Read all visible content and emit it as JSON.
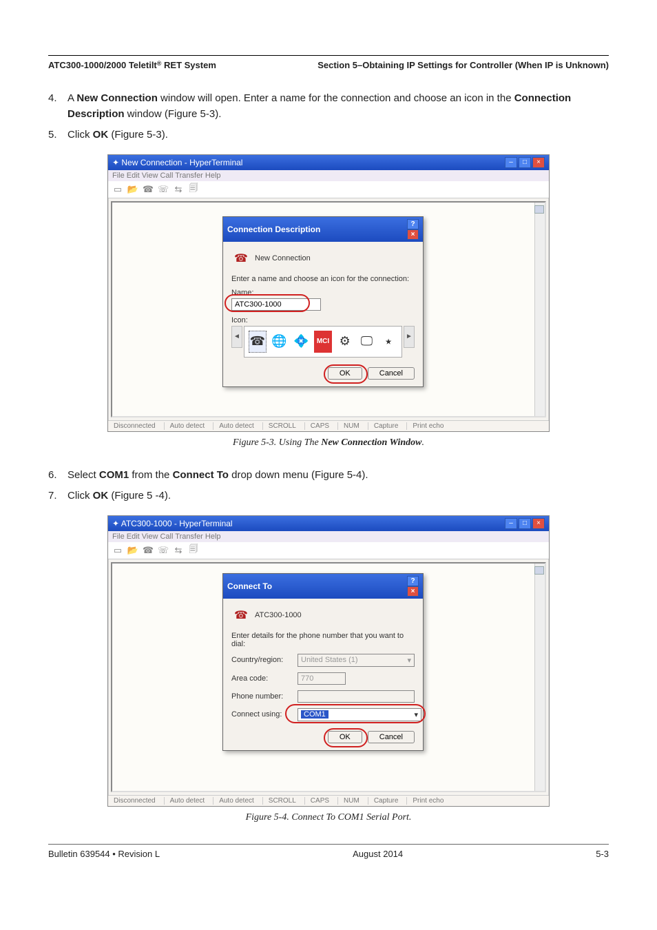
{
  "header": {
    "left": "ATC300-1000/2000 Teletilt",
    "reg": "®",
    "left2": " RET System",
    "right": "Section 5–Obtaining IP Settings for Controller (When IP is Unknown)"
  },
  "steps_a": [
    {
      "n": "4.",
      "pre": "A ",
      "b1": "New Connection",
      "mid": " window will open. Enter a name for the connection and choose an icon in the ",
      "b2": "Connection Description",
      "post": " window (Figure 5-3)."
    },
    {
      "n": "5.",
      "pre": "Click ",
      "b1": "OK",
      "mid": " (Figure 5-3).",
      "b2": "",
      "post": ""
    }
  ],
  "steps_b": [
    {
      "n": "6.",
      "pre": "Select ",
      "b1": "COM1",
      "mid": " from the ",
      "b2": "Connect To",
      "post": " drop down menu (Figure 5-4)."
    },
    {
      "n": "7.",
      "pre": "Click ",
      "b1": "OK",
      "mid": " (Figure 5 -4).",
      "b2": "",
      "post": ""
    }
  ],
  "fig1": {
    "win_title": "New Connection - HyperTerminal",
    "menu": "File  Edit  View  Call  Transfer  Help",
    "dlg_title": "Connection Description",
    "lead": "New Connection",
    "prompt": "Enter a name and choose an icon for the connection:",
    "name_label": "Name:",
    "name_value": "ATC300-1000",
    "icon_label": "Icon:",
    "ok": "OK",
    "cancel": "Cancel",
    "status": [
      "Disconnected",
      "Auto detect",
      "Auto detect",
      "SCROLL",
      "CAPS",
      "NUM",
      "Capture",
      "Print echo"
    ],
    "caption": "Figure 5-3.  Using The New Connection Window."
  },
  "fig2": {
    "win_title": "ATC300-1000 - HyperTerminal",
    "menu": "File  Edit  View  Call  Transfer  Help",
    "dlg_title": "Connect To",
    "lead": "ATC300-1000",
    "prompt": "Enter details for the phone number that you want to dial:",
    "country_label": "Country/region:",
    "country_value": "United States (1)",
    "area_label": "Area code:",
    "area_value": "770",
    "phone_label": "Phone number:",
    "phone_value": "",
    "connect_label": "Connect using:",
    "connect_value": "COM1",
    "ok": "OK",
    "cancel": "Cancel",
    "status": [
      "Disconnected",
      "Auto detect",
      "Auto detect",
      "SCROLL",
      "CAPS",
      "NUM",
      "Capture",
      "Print echo"
    ],
    "caption": "Figure 5-4.  Connect To COM1 Serial Port."
  },
  "footer": {
    "left": "Bulletin 639544  •  Revision L",
    "center": "August 2014",
    "right": "5-3"
  }
}
